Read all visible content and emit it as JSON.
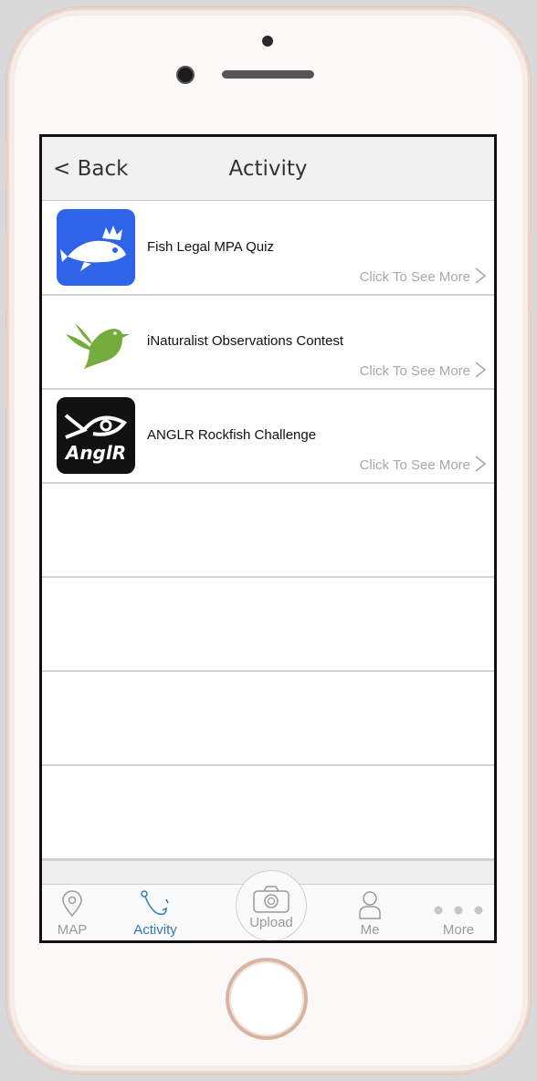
{
  "navbar": {
    "back_label": "< Back",
    "title": "Activity"
  },
  "activities": [
    {
      "title": "Fish Legal MPA Quiz",
      "more_label": "Click To See More",
      "icon": "fishbrain-icon",
      "icon_bg": "#2f64e8"
    },
    {
      "title": "iNaturalist Observations Contest",
      "more_label": "Click To See More",
      "icon": "inaturalist-bird-icon",
      "icon_bg": "#ffffff"
    },
    {
      "title": "ANGLR Rockfish Challenge",
      "more_label": "Click To See More",
      "icon": "anglr-logo-icon",
      "icon_bg": "#111111"
    }
  ],
  "tabs": [
    {
      "label": "MAP",
      "icon": "map-pin-icon"
    },
    {
      "label": "Activity",
      "icon": "fishing-hook-icon",
      "active": true
    },
    {
      "label": "Upload",
      "icon": "camera-icon"
    },
    {
      "label": "Me",
      "icon": "user-icon"
    },
    {
      "label": "More",
      "icon": "ellipsis-icon"
    }
  ],
  "colors": {
    "accent": "#2d79b5",
    "muted": "#9a9a9a"
  }
}
